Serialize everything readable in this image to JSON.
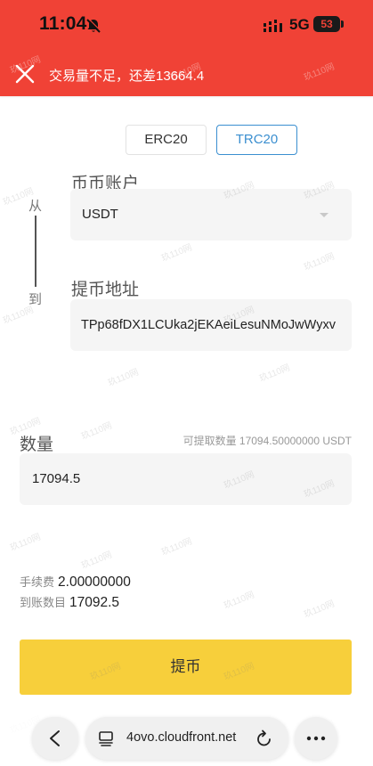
{
  "status_bar": {
    "time": "11:04",
    "network": "5G",
    "battery": "53"
  },
  "toast": {
    "message": "交易量不足，还差13664.4"
  },
  "tabs": [
    {
      "label": "ERC20",
      "selected": false
    },
    {
      "label": "TRC20",
      "selected": true
    }
  ],
  "transfer": {
    "from_label": "从",
    "to_label": "到",
    "account_label": "币币账户",
    "account_value": "USDT",
    "address_label": "提币地址",
    "address_value": "TPp68fDX1LCUka2jEKAeiLesuNMoJwWyxv"
  },
  "amount": {
    "label": "数量",
    "available": "可提取数量 17094.50000000 USDT",
    "value": "17094.5"
  },
  "fee": {
    "label": "手续费",
    "value": "2.00000000"
  },
  "receive": {
    "label": "到账数目",
    "value": "17092.5"
  },
  "submit_label": "提币",
  "browser": {
    "url": "4ovo.cloudfront.net"
  },
  "watermark": "玖110网",
  "colors": {
    "toast_red": "#f04236",
    "accent_blue": "#3b8fd0",
    "submit_yellow": "#f7cf3b"
  }
}
